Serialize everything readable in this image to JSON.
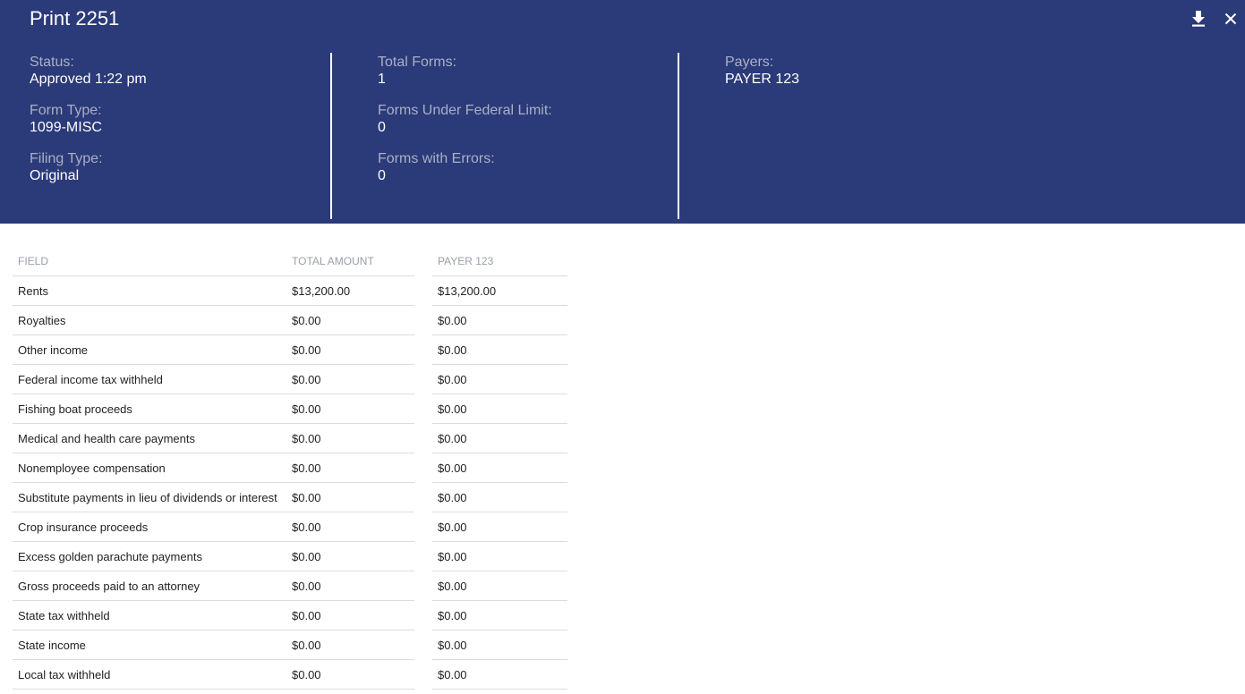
{
  "header": {
    "title": "Print 2251",
    "icons": {
      "download": "download-icon",
      "close": "close-icon"
    }
  },
  "summary": {
    "status_label": "Status:",
    "status_value": "Approved 1:22 pm",
    "form_type_label": "Form Type:",
    "form_type_value": "1099-MISC",
    "filing_type_label": "Filing Type:",
    "filing_type_value": "Original",
    "total_forms_label": "Total Forms:",
    "total_forms_value": "1",
    "under_limit_label": "Forms Under Federal Limit:",
    "under_limit_value": "0",
    "errors_label": "Forms with Errors:",
    "errors_value": "0",
    "payers_label": "Payers:",
    "payers_value": "PAYER 123"
  },
  "table": {
    "headers": [
      "FIELD",
      "TOTAL AMOUNT",
      "PAYER 123"
    ],
    "rows": [
      {
        "field": "Rents",
        "total": "$13,200.00",
        "payer": "$13,200.00"
      },
      {
        "field": "Royalties",
        "total": "$0.00",
        "payer": "$0.00"
      },
      {
        "field": "Other income",
        "total": "$0.00",
        "payer": "$0.00"
      },
      {
        "field": "Federal income tax withheld",
        "total": "$0.00",
        "payer": "$0.00"
      },
      {
        "field": "Fishing boat proceeds",
        "total": "$0.00",
        "payer": "$0.00"
      },
      {
        "field": "Medical and health care payments",
        "total": "$0.00",
        "payer": "$0.00"
      },
      {
        "field": "Nonemployee compensation",
        "total": "$0.00",
        "payer": "$0.00"
      },
      {
        "field": "Substitute payments in lieu of dividends or interest",
        "total": "$0.00",
        "payer": "$0.00"
      },
      {
        "field": "Crop insurance proceeds",
        "total": "$0.00",
        "payer": "$0.00"
      },
      {
        "field": "Excess golden parachute payments",
        "total": "$0.00",
        "payer": "$0.00"
      },
      {
        "field": "Gross proceeds paid to an attorney",
        "total": "$0.00",
        "payer": "$0.00"
      },
      {
        "field": "State tax withheld",
        "total": "$0.00",
        "payer": "$0.00"
      },
      {
        "field": "State income",
        "total": "$0.00",
        "payer": "$0.00"
      },
      {
        "field": "Local tax withheld",
        "total": "$0.00",
        "payer": "$0.00"
      }
    ]
  },
  "colors": {
    "header_bg": "#2b3a78",
    "label_muted": "#a9b0c8"
  }
}
